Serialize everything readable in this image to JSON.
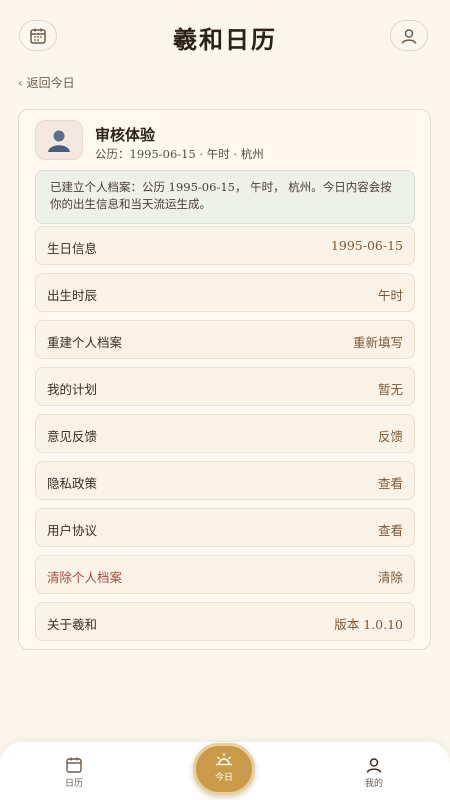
{
  "header": {
    "title": "羲和日历",
    "left_icon": "calendar-icon",
    "right_icon": "user-icon",
    "back_label": "‹ 返回今日"
  },
  "profile": {
    "name": "审核体验",
    "meta": "公历：1995-06-15 · 午时 · 杭州",
    "avatar_icon": "person-icon"
  },
  "notice": {
    "text": "已建立个人档案：公历 1995-06-15， 午时， 杭州。今日内容会按你的出生信息和当天流运生成。"
  },
  "settings": [
    {
      "label": "生日信息",
      "value": "1995-06-15"
    },
    {
      "label": "出生时辰",
      "value": "午时"
    },
    {
      "label": "重建个人档案",
      "value": "重新填写"
    },
    {
      "label": "我的计划",
      "value": "暂无"
    },
    {
      "label": "意见反馈",
      "value": "反馈"
    },
    {
      "label": "隐私政策",
      "value": "查看"
    },
    {
      "label": "用户协议",
      "value": "查看"
    },
    {
      "label": "清除个人档案",
      "value": "清除"
    },
    {
      "label": "关于羲和",
      "value": "版本 1.0.10"
    }
  ],
  "bottom_nav": {
    "calendar_label": "日历",
    "today_label": "今日",
    "me_label": "我的"
  },
  "colors": {
    "background": "#fbf7ee",
    "accent": "#c89a4a",
    "danger": "#a84a3e"
  }
}
